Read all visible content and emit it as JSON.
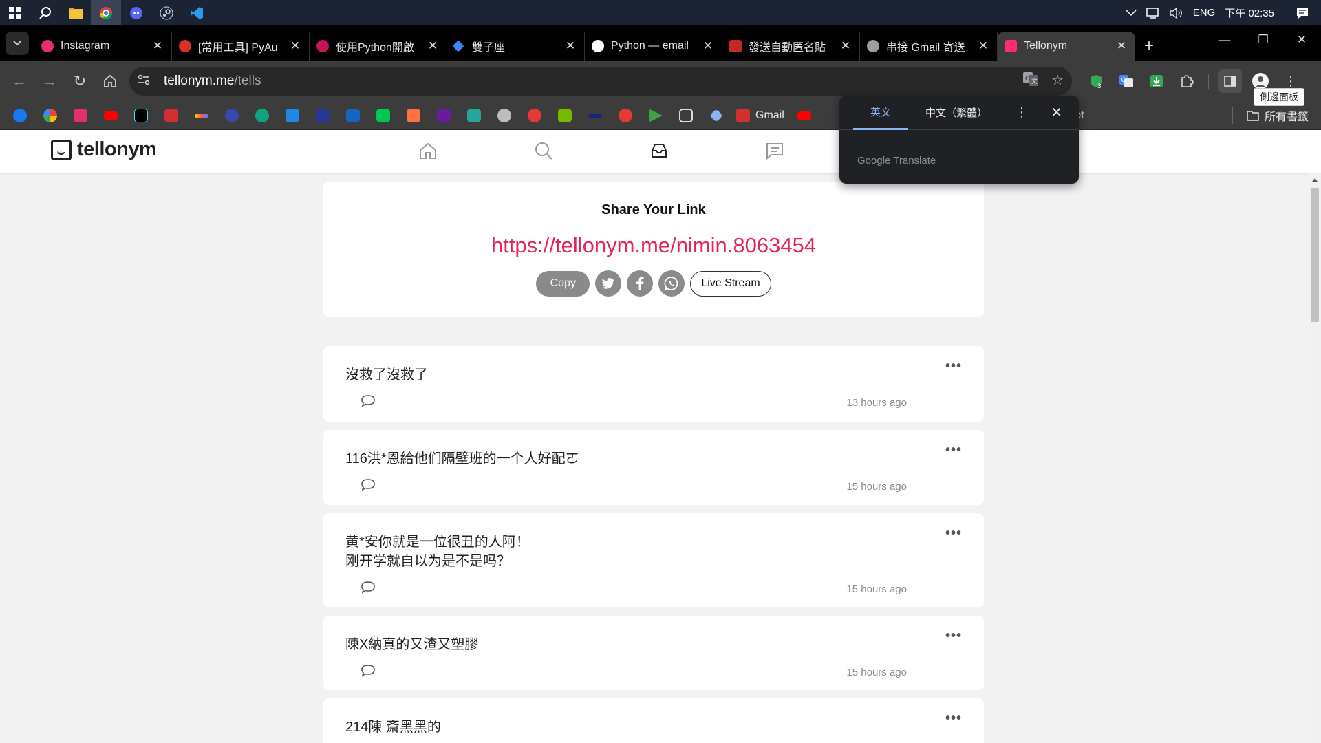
{
  "taskbar": {
    "language": "ENG",
    "time": "下午 02:35"
  },
  "tabs": [
    {
      "title": "Instagram",
      "color": "#e1306c"
    },
    {
      "title": "[常用工具] PyAu",
      "color": "#d93025"
    },
    {
      "title": "使用Python開啟",
      "color": "#c2185b"
    },
    {
      "title": "雙子座",
      "color": "#4285f4"
    },
    {
      "title": "Python — email",
      "color": "#ffffff"
    },
    {
      "title": "發送自動匿名貼",
      "color": "#c62828"
    },
    {
      "title": "串接 Gmail 寄送",
      "color": "#9e9e9e"
    },
    {
      "title": "Tellonym",
      "color": "#ff2d6f"
    }
  ],
  "address": {
    "host": "tellonym.me",
    "path": "/tells"
  },
  "bookmarks": {
    "gmail": "Gmail",
    "copilot": "Copilot",
    "all_bookmarks": "所有書籤",
    "colors": [
      "#1877f2",
      "#ea4335",
      "#e1306c",
      "#ff0000",
      "#010101",
      "#d32f2f",
      "#ffd600",
      "#7e57c2",
      "#10a37f",
      "#1e88e5",
      "#283593",
      "#1565c0",
      "#00c853",
      "#ff7043",
      "#6a1b9a",
      "#26a69a",
      "#bdbdbd",
      "#e53935",
      "#76b900",
      "#1a237e",
      "#e53935",
      "#43a047",
      "#9e9e9e",
      "#8ab4f8"
    ]
  },
  "tooltip": "側邊面板",
  "translate": {
    "tab_english": "英文",
    "tab_chinese": "中文（繁體）",
    "brand": "Google Translate"
  },
  "site": {
    "logo_text": "tellonym",
    "nav_icons": [
      "home-icon",
      "search-icon",
      "inbox-icon",
      "messages-icon"
    ]
  },
  "share": {
    "title": "Share Your Link",
    "link": "https://tellonym.me/nimin.8063454",
    "copy_label": "Copy",
    "live_label": "Live Stream"
  },
  "tells": [
    {
      "text": "沒救了沒救了",
      "time": "13 hours ago"
    },
    {
      "text": "116洪*恩給他们隔壁班的一个人好配ㄛ",
      "time": "15 hours ago"
    },
    {
      "text": "黄*安你就是一位很丑的人阿！\n刚开学就自以为是不是吗？",
      "time": "15 hours ago"
    },
    {
      "text": "陳X納真的又渣又塑膠",
      "time": "15 hours ago"
    },
    {
      "text": "214陳 斎黑黑的",
      "time": ""
    }
  ]
}
